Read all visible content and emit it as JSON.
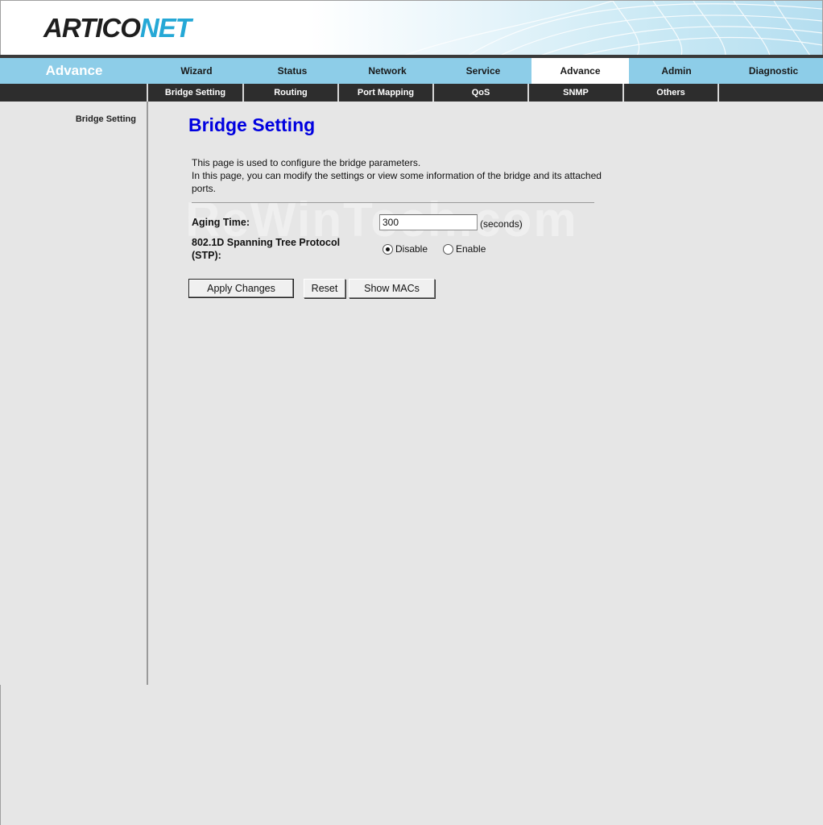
{
  "logo": {
    "part1": "ARTICO",
    "part2": "NET"
  },
  "section_title": "Advance",
  "main_nav": [
    {
      "label": "Wizard"
    },
    {
      "label": "Status"
    },
    {
      "label": "Network"
    },
    {
      "label": "Service"
    },
    {
      "label": "Advance",
      "active": true
    },
    {
      "label": "Admin"
    },
    {
      "label": "Diagnostic"
    }
  ],
  "sub_nav": [
    {
      "label": "Bridge Setting",
      "active": true
    },
    {
      "label": "Routing"
    },
    {
      "label": "Port Mapping"
    },
    {
      "label": "QoS"
    },
    {
      "label": "SNMP"
    },
    {
      "label": "Others"
    }
  ],
  "sidebar": {
    "items": [
      {
        "label": "Bridge Setting"
      }
    ]
  },
  "content": {
    "title": "Bridge Setting",
    "description_line1": "This page is used to configure the bridge parameters.",
    "description_line2": "In this page, you can modify the settings or view some information of the bridge and its attached ports.",
    "aging_time_label": "Aging Time:",
    "aging_time_value": "300",
    "aging_time_units": "(seconds)",
    "stp_label": "802.1D Spanning Tree Protocol (STP):",
    "stp_options": [
      {
        "label": "Disable",
        "checked": true
      },
      {
        "label": "Enable",
        "checked": false
      }
    ],
    "buttons": {
      "apply": "Apply Changes",
      "reset": "Reset",
      "show_macs": "Show MACs"
    },
    "watermark": "ReWinTech.com"
  },
  "colors": {
    "nav_bg": "#8dcde8",
    "subnav_bg": "#2d2d2d",
    "title_blue": "#0000e0",
    "logo_blue": "#25a8d6",
    "page_bg": "#e6e6e6"
  }
}
